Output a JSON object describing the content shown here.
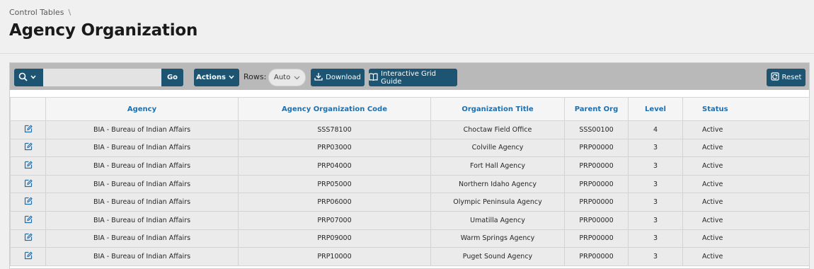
{
  "breadcrumb": {
    "parent": "Control Tables",
    "separator": "\\"
  },
  "page": {
    "title": "Agency Organization"
  },
  "toolbar": {
    "search_icon": "search-icon",
    "search_placeholder": "",
    "go_label": "Go",
    "actions_label": "Actions",
    "rows_label": "Rows:",
    "rows_value": "Auto",
    "download_label": "Download",
    "guide_label": "Interactive Grid Guide",
    "reset_label": "Reset"
  },
  "colors": {
    "button": "#1c5472",
    "toolbar": "#b9b9b9",
    "header_text": "#1f6fad",
    "row_bg": "#ebebeb"
  },
  "grid": {
    "columns": [
      "",
      "Agency",
      "Agency Organization Code",
      "Organization Title",
      "Parent Org",
      "Level",
      "Status"
    ],
    "rows": [
      [
        "BIA - Bureau of Indian Affairs",
        "SSS78100",
        "Choctaw Field Office",
        "SSS00100",
        "4",
        "Active"
      ],
      [
        "BIA - Bureau of Indian Affairs",
        "PRP03000",
        "Colville Agency",
        "PRP00000",
        "3",
        "Active"
      ],
      [
        "BIA - Bureau of Indian Affairs",
        "PRP04000",
        "Fort Hall Agency",
        "PRP00000",
        "3",
        "Active"
      ],
      [
        "BIA - Bureau of Indian Affairs",
        "PRP05000",
        "Northern Idaho Agency",
        "PRP00000",
        "3",
        "Active"
      ],
      [
        "BIA - Bureau of Indian Affairs",
        "PRP06000",
        "Olympic Peninsula Agency",
        "PRP00000",
        "3",
        "Active"
      ],
      [
        "BIA - Bureau of Indian Affairs",
        "PRP07000",
        "Umatilla Agency",
        "PRP00000",
        "3",
        "Active"
      ],
      [
        "BIA - Bureau of Indian Affairs",
        "PRP09000",
        "Warm Springs Agency",
        "PRP00000",
        "3",
        "Active"
      ],
      [
        "BIA - Bureau of Indian Affairs",
        "PRP10000",
        "Puget Sound Agency",
        "PRP00000",
        "3",
        "Active"
      ]
    ]
  }
}
